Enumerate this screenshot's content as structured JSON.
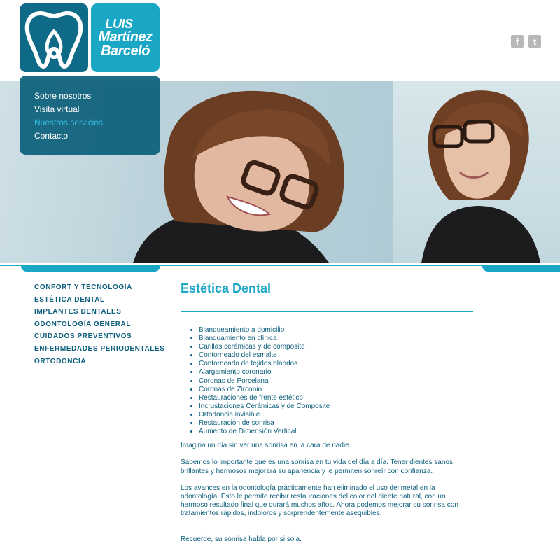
{
  "logo": {
    "name_line1": "LUIS",
    "name_line2": "Martínez",
    "name_line3": "Barceló"
  },
  "social": {
    "facebook_glyph": "f",
    "twitter_glyph": "t"
  },
  "nav": {
    "items": [
      {
        "label": "Sobre nosotros"
      },
      {
        "label": "Visita virtual"
      },
      {
        "label": "Nuestros servicios"
      },
      {
        "label": "Contacto"
      }
    ]
  },
  "side_menu": {
    "items": [
      {
        "label": "CONFORT Y TECNOLOGÍA"
      },
      {
        "label": "ESTÉTICA DENTAL"
      },
      {
        "label": "IMPLANTES DENTALES"
      },
      {
        "label": "ODONTOLOGÍA GENERAL"
      },
      {
        "label": "CUIDADOS PREVENTIVOS"
      },
      {
        "label": "ENFERMEDADES PERIODENTALES"
      },
      {
        "label": "ORTODONCIA"
      }
    ]
  },
  "content": {
    "title": "Estética Dental",
    "services": [
      "Blanqueamiento a domicilio",
      "Blanquamiento en clínica",
      "Carillas cerámicas y de composite",
      "Contorneado del esmalte",
      "Contorneado de tejidos blandos",
      "Alargamiento coronario",
      "Coronas de Porcelana",
      "Coronas de Zirconio",
      "Restauraciones de frente estético",
      "Incrustaciones Cerámicas y de Composite",
      "Ortodoncia invisible",
      "Restauración de sonrisa",
      "Aumento de Dimensión Vertical"
    ],
    "paragraph1": "Imagina un día sin ver una sonrisa en la cara de nadie.",
    "paragraph2": "Sabemos lo importante que es una sonrisa en tu vida del día a día. Tener dientes sanos, brillantes y hermosos mejorará su apariencia y le permiten sonreír con confianza.",
    "paragraph3": "Los avances en la odontología prácticamente han eliminado el uso del metal en la odontología. Esto le permite recibir restauraciones del color del diente natural, con un hermoso resultado final que durará muchos años. Ahora podemos mejorar su sonrisa con tratamientos rápidos, indoloros y sorprendentemente asequibles.",
    "paragraph4": "Recuerde, su sonrisa habla por si sola."
  },
  "colors": {
    "brand_dark": "#0e6a86",
    "brand_light": "#1aa7c6",
    "nav_active": "#33bde0",
    "text": "#0e5f7c"
  }
}
